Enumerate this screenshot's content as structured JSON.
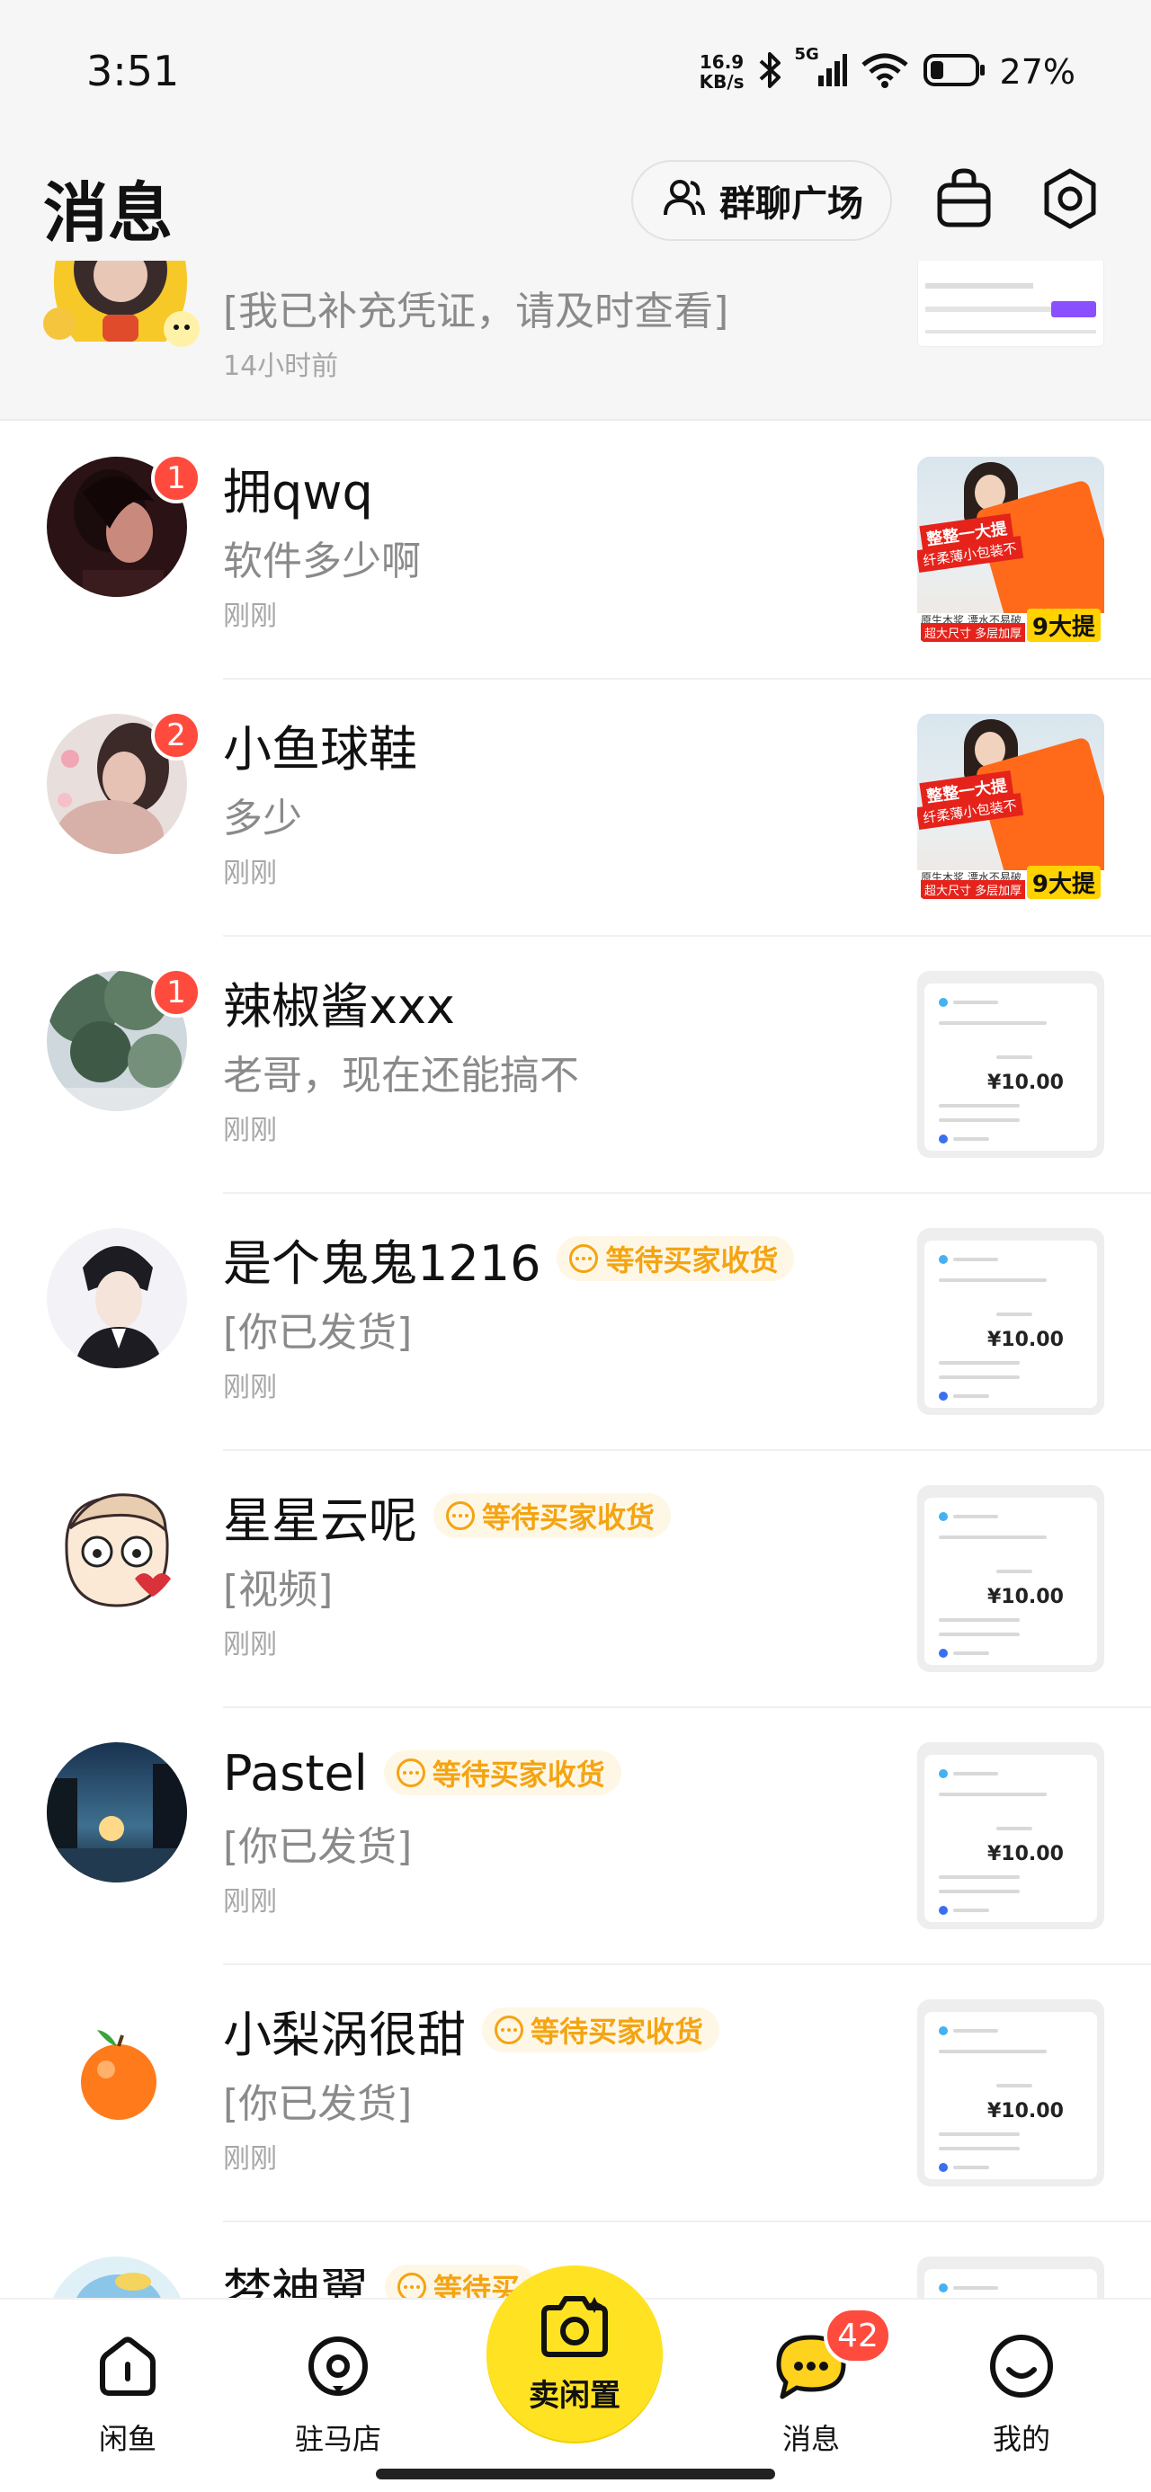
{
  "status_bar": {
    "time": "3:51",
    "net_speed_value": "16.9",
    "net_speed_unit": "KB/s",
    "network": "5G",
    "battery": "27%"
  },
  "header": {
    "title": "消息",
    "group_plaza_label": "群聊广场"
  },
  "top_item": {
    "message": "[我已补充凭证，请及时查看]",
    "time": "14小时前"
  },
  "conversations": [
    {
      "name": "拥qwq",
      "preview": "软件多少啊",
      "time": "刚刚",
      "unread": "1",
      "status": ""
    },
    {
      "name": "小鱼球鞋",
      "preview": "多少",
      "time": "刚刚",
      "unread": "2",
      "status": ""
    },
    {
      "name": "辣椒酱xxx",
      "preview": "老哥，现在还能搞不",
      "time": "刚刚",
      "unread": "1",
      "status": ""
    },
    {
      "name": "是个鬼鬼1216",
      "preview": "[你已发货]",
      "time": "刚刚",
      "unread": "",
      "status": "等待买家收货"
    },
    {
      "name": "星星云呢",
      "preview": "[视频]",
      "time": "刚刚",
      "unread": "",
      "status": "等待买家收货"
    },
    {
      "name": "Pastel",
      "preview": "[你已发货]",
      "time": "刚刚",
      "unread": "",
      "status": "等待买家收货"
    },
    {
      "name": "小梨涡很甜",
      "preview": "[你已发货]",
      "time": "刚刚",
      "unread": "",
      "status": "等待买家收货"
    },
    {
      "name": "梦神翼",
      "preview": "",
      "time": "",
      "unread": "",
      "status": "等待买"
    }
  ],
  "thumb_text": {
    "price": "¥10.00",
    "tissue_banner": "整整一大提",
    "tissue_sub": "纤柔薄小包装不",
    "tissue_strip": "原生木浆 漂水不易破",
    "tissue_red": "超大尺寸 多层加厚",
    "tissue_count": "9大提"
  },
  "bottom_nav": {
    "home": "闲鱼",
    "store": "驻马店",
    "sell": "卖闲置",
    "messages": "消息",
    "messages_badge": "42",
    "me": "我的"
  },
  "colors": {
    "accent_yellow": "#ffe322",
    "badge_red": "#ff4b3e",
    "status_orange": "#f4a412"
  }
}
